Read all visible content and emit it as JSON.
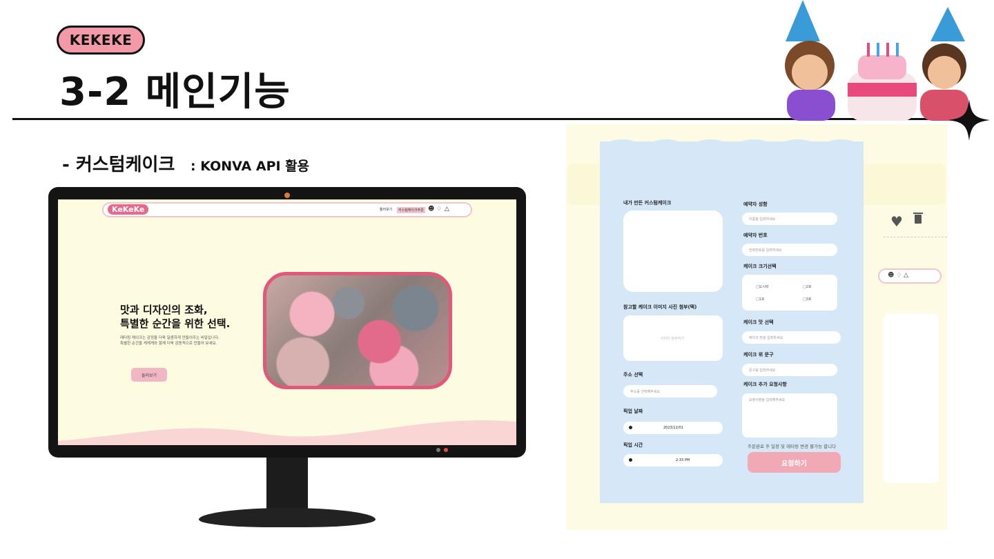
{
  "slide": {
    "badge": "KEKEKE",
    "title": "3-2 메인기능",
    "subtitle": "- 커스텀케이크",
    "subtitle_api": ": KONVA API 활용"
  },
  "site": {
    "logo": "KeKeKe",
    "nav": [
      "둘러보기",
      "커스텀케이크주문"
    ],
    "hero_title_1": "맛과 디자인의 조화,",
    "hero_title_2": "특별한 순간을 위한 선택.",
    "hero_desc_1": "레터링 케이크는 감정을 더욱 달콤하게 만들어주는 비밀입니다.",
    "hero_desc_2": "특별한 순간을 케케케와 함께 더욱 감동적으로 만들어 보세요.",
    "hero_button": "둘러보기"
  },
  "form": {
    "my_cake_label": "내가 만든 커스텀케이크",
    "ref_image_label": "참고할 케이크 이미지 사진 첨부(택)",
    "ref_image_placeholder": "이미지 첨부하기",
    "address_label": "주소 선택",
    "address_placeholder": "주소를 선택해주세요",
    "pickup_date_label": "픽업 날짜",
    "pickup_date_value": "2023/12/01",
    "pickup_time_label": "픽업 시간",
    "pickup_time_value": "2:33 PM",
    "name_label": "예약자 성함",
    "name_placeholder": "이름을 입력하세요",
    "phone_label": "예약자 번호",
    "phone_placeholder": "전화번호를 입력하세요",
    "size_label": "케이크 크기선택",
    "sizes": [
      "도시락",
      "2호",
      "1호",
      "3호"
    ],
    "flavor_label": "케이크 맛 선택",
    "flavor_placeholder": "케이크 맛을 입력하세요",
    "text_label": "케이크 위 문구",
    "text_placeholder": "문구를 입력하세요",
    "request_label": "케이크 추가 요청사항",
    "request_placeholder": "요청사항을 입력해주세요",
    "notice": "주문완료 후 일정 및 레터링 변경 불가능 합니다",
    "submit": "요청하기"
  }
}
